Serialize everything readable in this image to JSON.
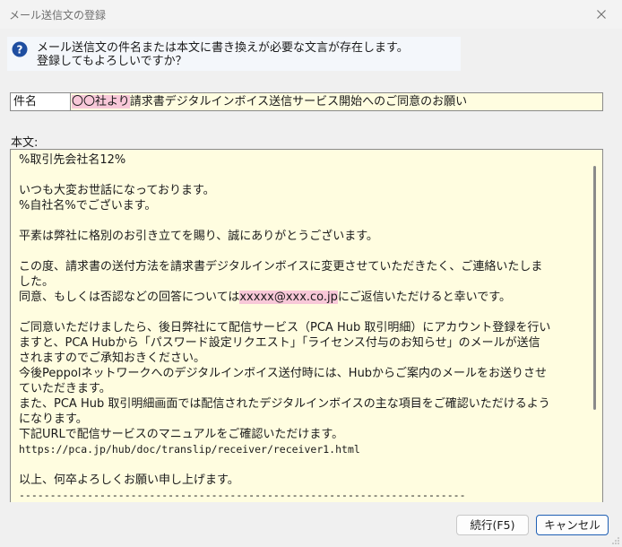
{
  "window": {
    "title": "メール送信文の登録",
    "close_glyph": "✕"
  },
  "message": {
    "icon": "question-icon",
    "line1": "メール送信文の件名または本文に書き換えが必要な文言が存在します。",
    "line2": "登録してもよろしいですか？"
  },
  "subject": {
    "label": "件名",
    "highlight": "〇〇社より",
    "rest": "請求書デジタルインボイス送信サービス開始へのご同意のお願い"
  },
  "body": {
    "label": "本文:",
    "lines": [
      "%取引先会社名12%",
      "",
      "いつも大変お世話になっております。",
      "%自社名%でございます。",
      "",
      "平素は弊社に格別のお引き立てを賜り、誠にありがとうございます。",
      "",
      "この度、請求書の送付方法を請求書デジタルインボイスに変更させていただきたく、ご連絡いたしま",
      "した。",
      "",
      "",
      "ご同意いただけましたら、後日弊社にて配信サービス（PCA Hub 取引明細）にアカウント登録を行い",
      "ますと、PCA Hubから「パスワード設定リクエスト」「ライセンス付与のお知らせ」のメールが送信",
      "されますのでご承知おきください。",
      "今後Peppolネットワークへのデジタルインボイス送付時には、Hubからご案内のメールをお送りさせ",
      "ていただきます。",
      "また、PCA Hub 取引明細画面では配信されたデジタルインボイスの主な項目をご確認いただけるよう",
      "になります。",
      "下記URLで配信サービスのマニュアルをご確認いただけます。",
      "",
      "",
      "以上、何卒よろしくお願い申し上げます。",
      "------------------------------------------------------------------------"
    ],
    "consent_prefix": "同意、もしくは否認などの回答については",
    "consent_email": "xxxxx@xxx.co.jp",
    "consent_suffix": "にご返信いただけると幸いです。",
    "url": "https://pca.jp/hub/doc/translip/receiver/receiver1.html"
  },
  "buttons": {
    "continue": "続行(F5)",
    "cancel": "キャンセル"
  },
  "colors": {
    "field_bg": "#fffde0",
    "highlight": "#f8c8d8",
    "default_button_border": "#1e5fb4"
  }
}
